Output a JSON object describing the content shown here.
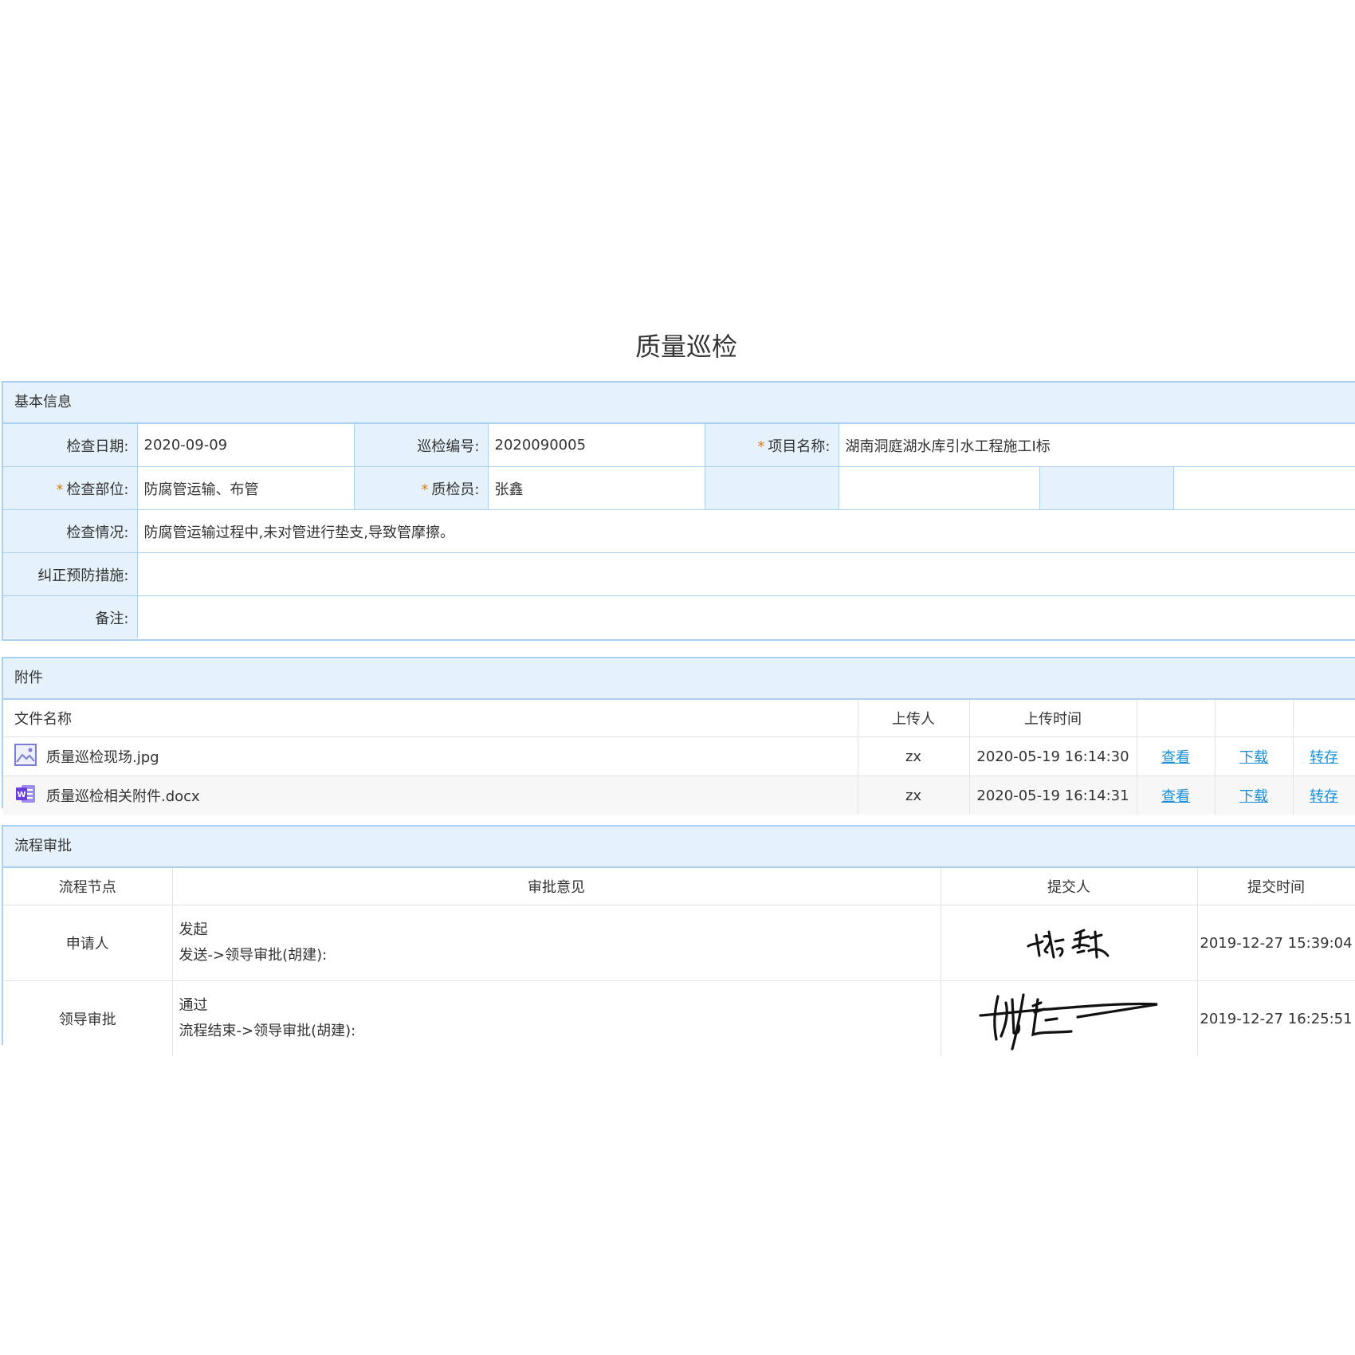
{
  "page_title": "质量巡检",
  "basic": {
    "section_title": "基本信息",
    "check_date_label": "检查日期:",
    "check_date": "2020-09-09",
    "patrol_no_label": "巡检编号:",
    "patrol_no": "2020090005",
    "project_name_label": "项目名称:",
    "project_name": "湖南洞庭湖水库引水工程施工I标",
    "check_part_label": "检查部位:",
    "check_part": "防腐管运输、布管",
    "inspector_label": "质检员:",
    "inspector": "张鑫",
    "situation_label": "检查情况:",
    "situation": "防腐管运输过程中,未对管进行垫支,导致管摩擦。",
    "measures_label": "纠正预防措施:",
    "measures": "",
    "remark_label": "备注:",
    "remark": "",
    "required_mark": "*"
  },
  "attachments": {
    "section_title": "附件",
    "headers": [
      "文件名称",
      "上传人",
      "上传时间"
    ],
    "files": [
      {
        "name": "质量巡检现场.jpg",
        "icon": "image-file-icon",
        "uploader": "zx",
        "time": "2020-05-19 16:14:30"
      },
      {
        "name": "质量巡检相关附件.docx",
        "icon": "word-file-icon",
        "uploader": "zx",
        "time": "2020-05-19 16:14:31"
      }
    ],
    "actions": {
      "view": "查看",
      "download": "下载",
      "save": "转存"
    }
  },
  "flow": {
    "section_title": "流程审批",
    "headers": [
      "流程节点",
      "审批意见",
      "提交人",
      "提交时间"
    ],
    "rows": [
      {
        "node": "申请人",
        "opinion_1": "发起",
        "opinion_2": "发送->领导审批(胡建):",
        "submitter": "张鑫",
        "time": "2019-12-27 15:39:04"
      },
      {
        "node": "领导审批",
        "opinion_1": "通过",
        "opinion_2": "流程结束->领导审批(胡建):",
        "submitter": "胡建",
        "time": "2019-12-27 16:25:51"
      }
    ]
  }
}
